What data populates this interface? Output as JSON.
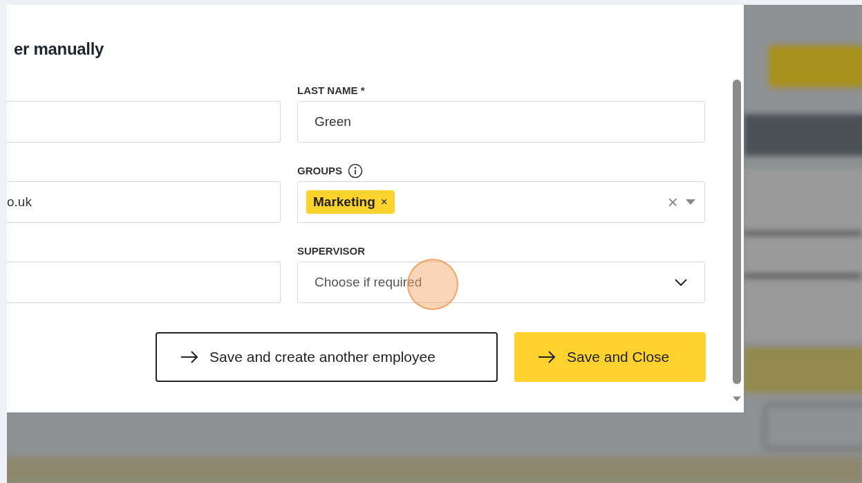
{
  "dialog": {
    "title": "er manually",
    "left_fields": [
      {
        "kind": "input"
      },
      {
        "kind": "input",
        "value": "o.uk"
      },
      {
        "kind": "input"
      }
    ],
    "right_fields": [
      {
        "label": "LAST NAME *",
        "kind": "input",
        "value": "Green"
      },
      {
        "label": "GROUPS",
        "kind": "multiselect",
        "info": true,
        "chips": [
          {
            "label": "Marketing",
            "remove": "×"
          }
        ],
        "clear": "×"
      },
      {
        "label": "SUPERVISOR",
        "kind": "select",
        "placeholder": "Choose if required"
      }
    ],
    "buttons": [
      {
        "label": "Save and create another employee",
        "kind": "secondary"
      },
      {
        "label": "Save and Close",
        "kind": "primary"
      }
    ]
  }
}
